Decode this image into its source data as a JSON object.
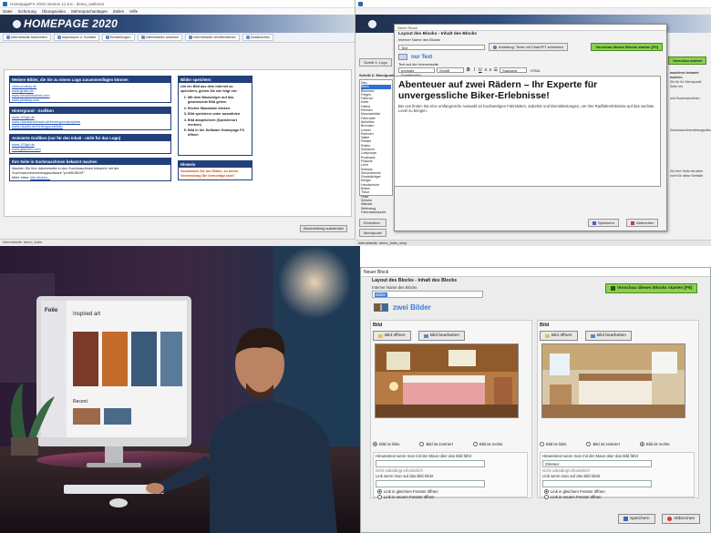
{
  "top_left": {
    "title": "HomepageFX 2020 Version 11.5.6 - demo_weltreim",
    "menu": [
      "Datei",
      "Sicherung",
      "Übungsvideo",
      "Mehrsprachanlagen",
      "Zeilen",
      "Hilfe"
    ],
    "banner": "HOMEPAGE 2020",
    "toolbar": [
      "Internetseite bearbeiten",
      "Impressum u. Kontakt",
      "Einstellungen",
      "Internetseite ansehen",
      "Internetseite veröffentlichen",
      "Zusätzliches"
    ],
    "box1_head": "Weitere Bilder, die Sie zu einem Logo zusammenfügen können",
    "box1_links": [
      "www.pixabay.de",
      "www.gratis.de",
      "www.fotosbibliothek.com",
      "www.pixabay.com"
    ],
    "box2_head": "Hintergrund - Grafiken",
    "box2_links": [
      "www.123gif.de",
      "www.clickstandimmer.de/hintergrundprojekte",
      "www.cliparts.de/hintergrundbilder"
    ],
    "box3_head": "Animierte Grafiken (nur für den Inhalt - nicht für das Logo)",
    "box3_links": [
      "www.123gif.de",
      "www.gifanimo.com"
    ],
    "box4_head": "Ihre Seite in Suchmaschinen bekannt machen",
    "box4_text": "Machen Sie Ihre Internetseite in den Suchmaschinen bekannt, mit der Suchmaschineneintragssoftware \"profiSUBMIT\".",
    "box4_more": "Mehr Infos:",
    "box4_link": "hier klicken...",
    "box5_head": "Bilder speichern",
    "box5_text": "Um ein Bild aus dem Internet zu speichern, gehen Sie wie folgt vor:",
    "box5_steps": [
      "Mit dem Mauszeiger auf das gewünschte Bild gehen",
      "Rechte Maustaste klicken",
      "Bild speichern unter auswählen",
      "Bild abspeichern (Speicherort merken)",
      "Bild in der Software Homepage FX öffnen"
    ],
    "box6_head": "Hinweis",
    "box6_text": "Verwenden Sie nur Bilder, zu deren Verwendung Sie berechtigt sind!",
    "button": "Beschreibung ausblenden",
    "status": "Internetseite: demo_fodrs"
  },
  "top_right": {
    "dialog_title": "Neuer Block",
    "dialog_head": "Layout des Blocks - Inhalt des Blocks",
    "name_label": "Interner Name des Blocks",
    "name_value": "Text",
    "chatgpt_btn": "Anleitung: Texte mit ChatGPT schreiben",
    "preview_btn": "Vorschau dieses Blocks starten [F9]",
    "mode": "nur Text",
    "text_label": "Text auf der Internetseite",
    "font_select": "normale Schriftgröße",
    "font_name": "Schrift",
    "style_select": "Standard",
    "html_label": "HTML",
    "headline": "Abenteuer auf zwei Rädern – Ihr Experte für unvergessliche Biker-Erlebnisse!",
    "body": "Bei uns finden Sie eine umfangreiche Auswahl an hochwertigen Fahrrädern, Zubehör und Dienstleistungen, um Ihre Radfahrerlebnisse auf das nächste Level zu bringen.",
    "list_items": [
      "Neu",
      "Bikes",
      "Bikeinsel",
      "Felgen",
      "Fahrrad",
      "Kette",
      "Helme",
      "Rennen",
      "Mountainbike",
      "Fahrrader",
      "Aktuelles",
      "Bremsen",
      "Lenker",
      "Rahmen",
      "Sattel",
      "Pedale",
      "Reifen",
      "Schlauch",
      "Luftpumpe",
      "Rucksack",
      "Flasche",
      "Licht",
      "Schloss",
      "Schutzbleche",
      "Gepäckträger",
      "Klingel",
      "Handschuhe",
      "Brillen",
      "Trikot",
      "Hose",
      "Schuhe",
      "Ständer",
      "Werkzeug",
      "Fahrradcomputer"
    ],
    "save_btn": "Speichern",
    "cancel_btn": "Abbrechen",
    "bg_step": "Schritt 2: Menüpunkt",
    "bg_btn": "Schritt 1: Logo",
    "bg_side": [
      "machinen bekannt machen",
      "Sie für Ihr Menüpunkt",
      "Seite ein",
      "und Suchmaschinen",
      "Suchmaschineneintragsoftware",
      "Sie Ihre Seite bei allen",
      "nicht für diese Website"
    ],
    "bg_preview": "Vorschau starten",
    "bg_buttons": [
      "Einrichten",
      "Menüpunkt"
    ],
    "status": "Internetseite: demo_fodrs_shop"
  },
  "bottom_left": {
    "screen_brand": "Folio",
    "screen_heading": "Inspired art",
    "screen_section": "Recent"
  },
  "bottom_right": {
    "title": "Neuer Block",
    "head": "Layout des Blocks - Inhalt des Blocks",
    "name_label": "Interner Name des Blocks",
    "name_value": "Bilder",
    "preview_btn": "Vorschau dieses Blocks starten [F9]",
    "mode": "zwei Bilder",
    "left": {
      "heading": "Bild",
      "open_btn": "Bild öffnen",
      "edit_btn": "Bild bearbeiten",
      "align": [
        "Bild ist links",
        "Bild ist zentriert",
        "Bild ist rechts"
      ],
      "align_selected": 0,
      "hover_label": "Hinweistext wenn man mit der Maus über das Bild fährt",
      "hover_value": "",
      "optional": "nicht unbedingt erforderlich",
      "click_label": "Link wenn man auf das Bild klickt",
      "click_value": "",
      "window": [
        "Link in gleichem Fenster öffnen",
        "Link in neuem Fenster öffnen"
      ],
      "window_selected": 0
    },
    "right": {
      "heading": "Bild",
      "open_btn": "Bild öffnen",
      "edit_btn": "Bild bearbeiten",
      "align": [
        "Bild ist links",
        "Bild ist zentriert",
        "Bild ist rechts"
      ],
      "align_selected": 2,
      "hover_label": "Hinweistext wenn man mit der Maus über das Bild fährt",
      "hover_value": "Zimmer",
      "optional": "nicht unbedingt erforderlich",
      "click_label": "Link wenn man auf das Bild klickt",
      "click_value": "",
      "window": [
        "Link in gleichem Fenster öffnen",
        "Link in neuem Fenster öffnen"
      ],
      "window_selected": 0
    },
    "save_btn": "Speichern",
    "cancel_btn": "Abbrechen"
  },
  "colors": {
    "accent": "#22407a",
    "green": "#8ad04a",
    "link": "#1a4dbf",
    "warning": "#d0480e"
  }
}
